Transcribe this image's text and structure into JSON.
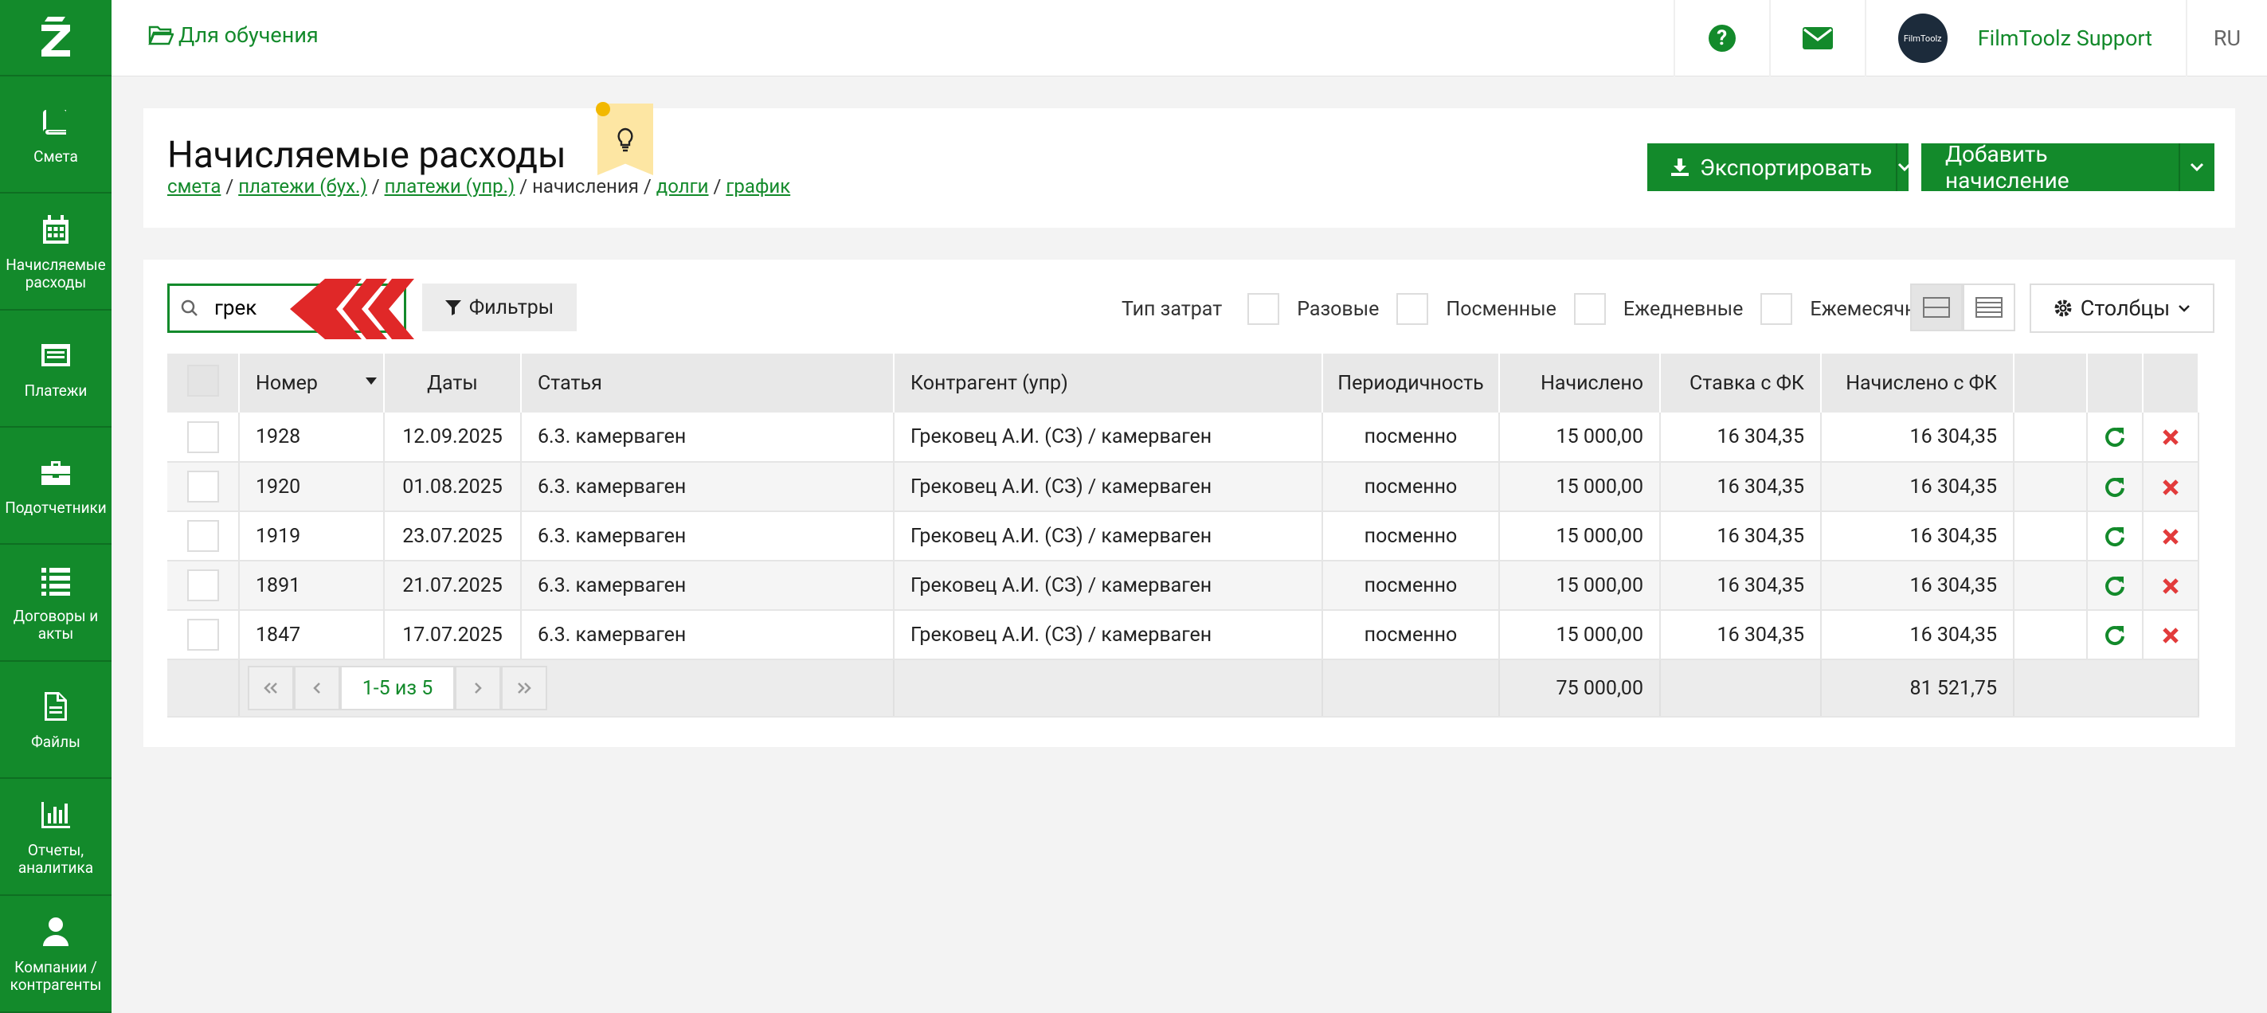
{
  "header": {
    "project": "Для обучения",
    "user_name": "FilmToolz Support",
    "avatar_text": "FilmToolz",
    "lang": "RU"
  },
  "sidebar": {
    "items": [
      {
        "label": "Смета",
        "icon": "book-icon"
      },
      {
        "label": "Начисляемые расходы",
        "icon": "calendar-icon"
      },
      {
        "label": "Платежи",
        "icon": "card-icon"
      },
      {
        "label": "Подотчетники",
        "icon": "briefcase-icon"
      },
      {
        "label": "Договоры и акты",
        "icon": "list-icon"
      },
      {
        "label": "Файлы",
        "icon": "file-icon"
      },
      {
        "label": "Отчеты, аналитика",
        "icon": "chart-icon"
      },
      {
        "label": "Компании / контрагенты",
        "icon": "user-icon"
      }
    ]
  },
  "page": {
    "title": "Начисляемые расходы",
    "breadcrumbs": {
      "smeta": "смета",
      "buh": "платежи (бух.)",
      "upr": "платежи (упр.)",
      "current": "начисления",
      "debts": "долги",
      "graph": "график"
    },
    "export_label": "Экспортировать",
    "add_label": "Добавить начисление"
  },
  "toolbar": {
    "search_value": "грек",
    "filters_label": "Фильтры",
    "cost_type_label": "Тип затрат",
    "cost_types": [
      "Разовые",
      "Посменные",
      "Ежедневные",
      "Ежемесячные"
    ],
    "columns_label": "Столбцы"
  },
  "table": {
    "headers": [
      "Номер",
      "Даты",
      "Статья",
      "Контрагент (упр)",
      "Периодичность",
      "Начислено",
      "Ставка с ФК",
      "Начислено с ФК"
    ],
    "rows": [
      {
        "num": "1928",
        "date": "12.09.2025",
        "article": "6.3. камерваген",
        "contractor": "Грековец А.И. (СЗ) / камерваген",
        "period": "посменно",
        "accrued": "15 000,00",
        "rate": "16 304,35",
        "accrued_fk": "16 304,35"
      },
      {
        "num": "1920",
        "date": "01.08.2025",
        "article": "6.3. камерваген",
        "contractor": "Грековец А.И. (СЗ) / камерваген",
        "period": "посменно",
        "accrued": "15 000,00",
        "rate": "16 304,35",
        "accrued_fk": "16 304,35"
      },
      {
        "num": "1919",
        "date": "23.07.2025",
        "article": "6.3. камерваген",
        "contractor": "Грековец А.И. (СЗ) / камерваген",
        "period": "посменно",
        "accrued": "15 000,00",
        "rate": "16 304,35",
        "accrued_fk": "16 304,35"
      },
      {
        "num": "1891",
        "date": "21.07.2025",
        "article": "6.3. камерваген",
        "contractor": "Грековец А.И. (СЗ) / камерваген",
        "period": "посменно",
        "accrued": "15 000,00",
        "rate": "16 304,35",
        "accrued_fk": "16 304,35"
      },
      {
        "num": "1847",
        "date": "17.07.2025",
        "article": "6.3. камерваген",
        "contractor": "Грековец А.И. (СЗ) / камерваген",
        "period": "посменно",
        "accrued": "15 000,00",
        "rate": "16 304,35",
        "accrued_fk": "16 304,35"
      }
    ],
    "pager": "1-5 из 5",
    "total_accrued": "75 000,00",
    "total_accrued_fk": "81 521,75"
  },
  "colors": {
    "brand": "#138a2b",
    "delete": "#e23b3b"
  }
}
